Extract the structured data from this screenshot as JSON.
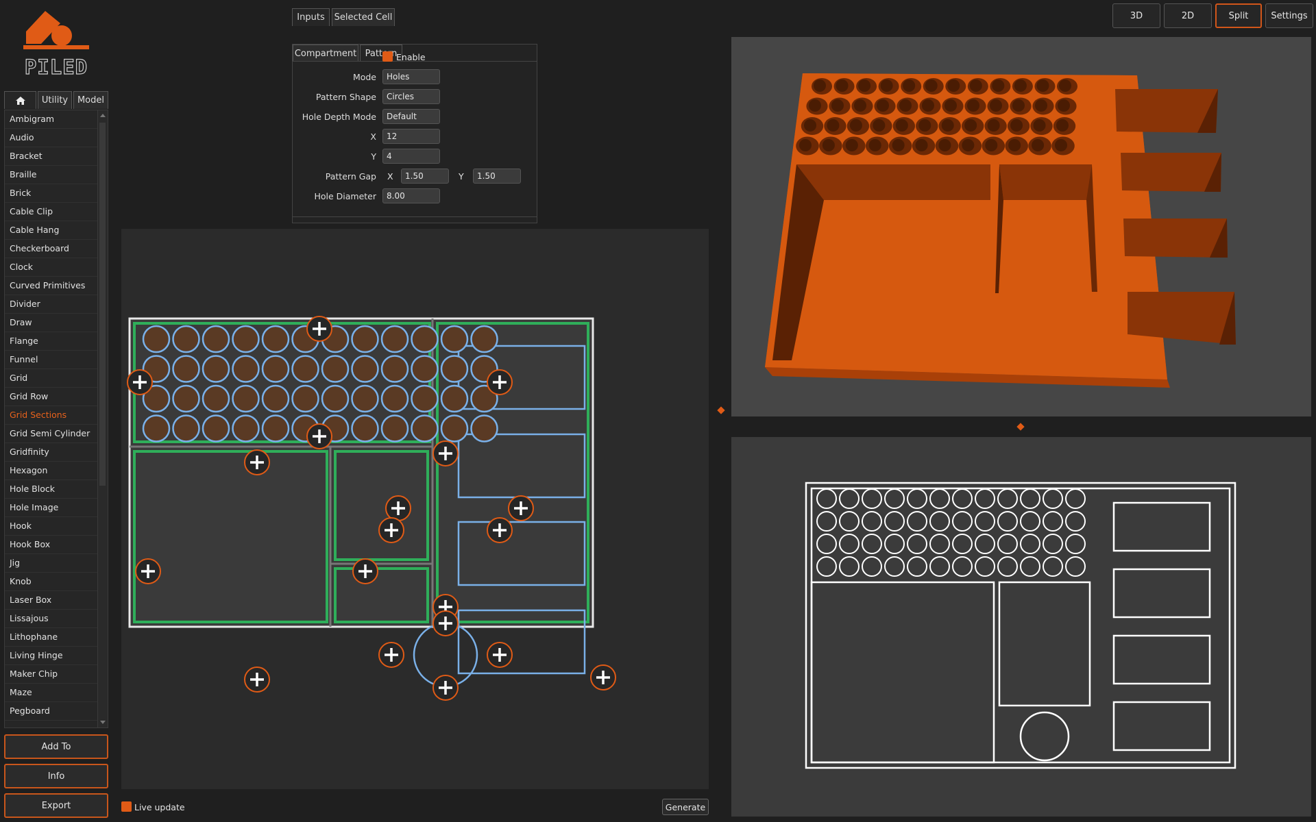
{
  "app": {
    "logo_text": "PILED"
  },
  "library": {
    "tabs": [
      {
        "label": "",
        "icon": "home-icon"
      },
      {
        "label": "Utility"
      },
      {
        "label": "Model"
      }
    ],
    "items": [
      "Ambigram",
      "Audio",
      "Bracket",
      "Braille",
      "Brick",
      "Cable Clip",
      "Cable Hang",
      "Checkerboard",
      "Clock",
      "Curved Primitives",
      "Divider",
      "Draw",
      "Flange",
      "Funnel",
      "Grid",
      "Grid Row",
      "Grid Sections",
      "Grid Semi Cylinder",
      "Gridfinity",
      "Hexagon",
      "Hole Block",
      "Hole Image",
      "Hook",
      "Hook Box",
      "Jig",
      "Knob",
      "Laser Box",
      "Lissajous",
      "Lithophane",
      "Living Hinge",
      "Maker Chip",
      "Maze",
      "Pegboard"
    ],
    "selected": "Grid Sections",
    "buttons": {
      "add_to": "Add To",
      "info": "Info",
      "export": "Export"
    }
  },
  "inputs_panel": {
    "tabs": [
      "Inputs",
      "Selected Cell"
    ],
    "subtabs": [
      "Compartment",
      "Pattern"
    ],
    "enable_label": "Enable",
    "fields": {
      "mode": {
        "label": "Mode",
        "value": "Holes"
      },
      "pattern_shape": {
        "label": "Pattern Shape",
        "value": "Circles"
      },
      "hole_depth_mode": {
        "label": "Hole Depth Mode",
        "value": "Default"
      },
      "x": {
        "label": "X",
        "value": "12"
      },
      "y": {
        "label": "Y",
        "value": "4"
      },
      "pattern_gap": {
        "label": "Pattern Gap",
        "x_label": "X",
        "x_value": "1.50",
        "y_label": "Y",
        "y_value": "1.50"
      },
      "hole_diameter": {
        "label": "Hole Diameter",
        "value": "8.00"
      }
    }
  },
  "editor": {
    "live_update_label": "Live update",
    "generate_label": "Generate"
  },
  "view_buttons": [
    "3D",
    "2D",
    "Split",
    "Settings"
  ],
  "active_view": "Split",
  "colors": {
    "accent": "#e05b16",
    "model": "#d6590f",
    "grid_green": "#2fae5a",
    "hole_blue": "#7ab0e8"
  }
}
